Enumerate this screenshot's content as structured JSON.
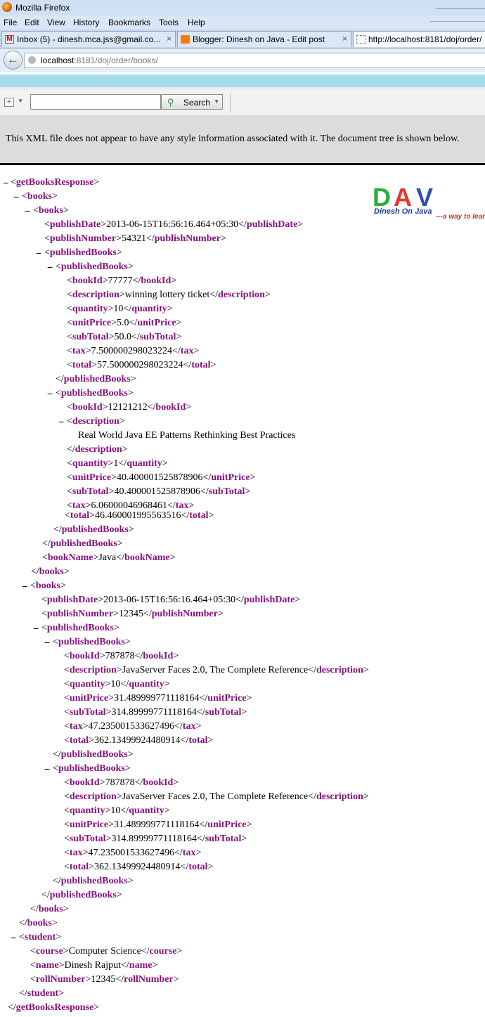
{
  "window": {
    "title": "Mozilla Firefox"
  },
  "menu": [
    "File",
    "Edit",
    "View",
    "History",
    "Bookmarks",
    "Tools",
    "Help"
  ],
  "tabs": [
    {
      "label": "Inbox (5) - dinesh.mca.jss@gmail.co...",
      "icon": "gmail-icon"
    },
    {
      "label": "Blogger: Dinesh on Java - Edit post",
      "icon": "blogger-icon"
    },
    {
      "label": "http://localhost:8181/doj/order/",
      "icon": "page-icon"
    }
  ],
  "tab_close": "×",
  "nav": {
    "url_host": "localhost",
    "url_rest": ":8181/doj/order/books/"
  },
  "search": {
    "button_label": "Search",
    "value": ""
  },
  "info_message": "This XML file does not appear to have any style information associated with it. The document tree is shown below.",
  "logo": {
    "letters": [
      "D",
      "A",
      "V"
    ],
    "subtitle": "Dinesh On Java",
    "tagline": "---a way to learn"
  },
  "toggle_symbol": "−",
  "xml_lines": [
    {
      "o": "getBooksResponse"
    },
    {
      "o": "books"
    },
    {
      "o": "books"
    },
    {
      "n": "publishDate",
      "v": "2013-06-15T16:56:16.464+05:30"
    },
    {
      "n": "publishNumber",
      "v": "54321"
    },
    {
      "o": "publishedBooks"
    },
    {
      "o": "publishedBooks"
    },
    {
      "n": "bookId",
      "v": "77777"
    },
    {
      "n": "description",
      "v": "winning lottery ticket"
    },
    {
      "n": "quantity",
      "v": "10"
    },
    {
      "n": "unitPrice",
      "v": "5.0"
    },
    {
      "n": "subTotal",
      "v": "50.0"
    },
    {
      "n": "tax",
      "v": "7.500000298023224"
    },
    {
      "n": "total",
      "v": "57.500000298023224"
    },
    {
      "c": "publishedBooks"
    },
    {
      "o": "publishedBooks"
    },
    {
      "n": "bookId",
      "v": "12121212"
    },
    {
      "o": "description"
    },
    {
      "t": "Real World Java EE Patterns Rethinking Best Practices"
    },
    {
      "c": "description"
    },
    {
      "n": "quantity",
      "v": "1"
    },
    {
      "n": "unitPrice",
      "v": "40.400001525878906"
    },
    {
      "n": "subTotal",
      "v": "40.400001525878906"
    },
    {
      "n": "tax",
      "v": "6.06000046968461"
    },
    {
      "n": "total",
      "v": "46.460001995563516"
    },
    {
      "c": "publishedBooks"
    },
    {
      "c": "publishedBooks"
    },
    {
      "n": "bookName",
      "v": "Java"
    },
    {
      "c": "books"
    },
    {
      "o": "books"
    },
    {
      "n": "publishDate",
      "v": "2013-06-15T16:56:16.464+05:30"
    },
    {
      "n": "publishNumber",
      "v": "12345"
    },
    {
      "o": "publishedBooks"
    },
    {
      "o": "publishedBooks"
    },
    {
      "n": "bookId",
      "v": "787878"
    },
    {
      "n": "description",
      "v": "JavaServer Faces 2.0, The Complete Reference"
    },
    {
      "n": "quantity",
      "v": "10"
    },
    {
      "n": "unitPrice",
      "v": "31.489999771118164"
    },
    {
      "n": "subTotal",
      "v": "314.89999771118164"
    },
    {
      "n": "tax",
      "v": "47.235001533627496"
    },
    {
      "n": "total",
      "v": "362.13499924480914"
    },
    {
      "c": "publishedBooks"
    },
    {
      "o": "publishedBooks"
    },
    {
      "n": "bookId",
      "v": "787878"
    },
    {
      "n": "description",
      "v": "JavaServer Faces 2.0, The Complete Reference"
    },
    {
      "n": "quantity",
      "v": "10"
    },
    {
      "n": "unitPrice",
      "v": "31.489999771118164"
    },
    {
      "n": "subTotal",
      "v": "314.89999771118164"
    },
    {
      "n": "tax",
      "v": "47.235001533627496"
    },
    {
      "n": "total",
      "v": "362.13499924480914"
    },
    {
      "c": "publishedBooks"
    },
    {
      "c": "publishedBooks"
    },
    {
      "c": "books"
    },
    {
      "c": "books"
    },
    {
      "o": "student"
    },
    {
      "n": "course",
      "v": "Computer Science"
    },
    {
      "n": "name",
      "v": "Dinesh Rajput"
    },
    {
      "n": "rollNumber",
      "v": "12345"
    },
    {
      "c": "student"
    },
    {
      "c": "getBooksResponse"
    }
  ]
}
